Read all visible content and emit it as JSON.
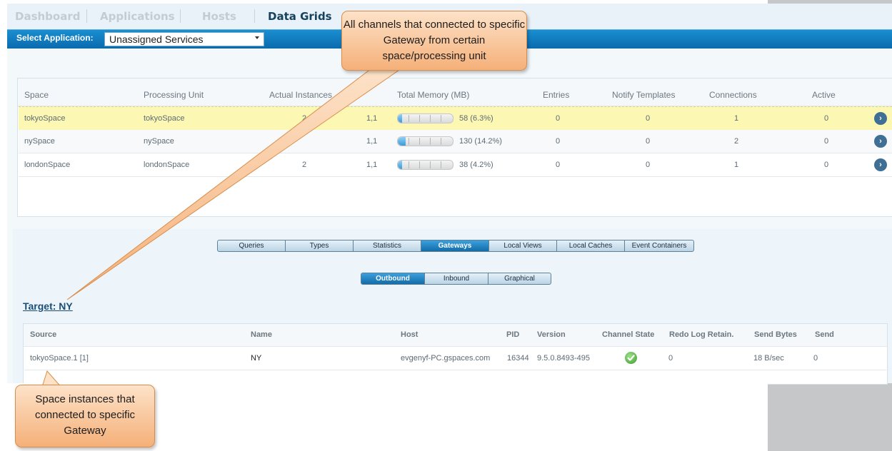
{
  "nav": {
    "items": [
      "Dashboard",
      "Applications",
      "Hosts",
      "Data Grids"
    ],
    "active": "Data Grids"
  },
  "select_application": {
    "label": "Select Application:",
    "value": "Unassigned Services"
  },
  "spaces_table": {
    "headers": [
      "Space",
      "Processing Unit",
      "Actual Instances",
      "Total Memory (MB)",
      "Entries",
      "Notify Templates",
      "Connections",
      "Active"
    ],
    "rows": [
      {
        "space": "tokyoSpace",
        "pu": "tokyoSpace",
        "instances": "2",
        "topology": "1,1",
        "memory": "58 (6.3%)",
        "memory_fill": 0.063,
        "entries": "0",
        "notify": "0",
        "connections": "1",
        "active": "0",
        "selected": true
      },
      {
        "space": "nySpace",
        "pu": "nySpace",
        "instances": "",
        "topology": "1,1",
        "memory": "130 (14.2%)",
        "memory_fill": 0.142,
        "entries": "0",
        "notify": "0",
        "connections": "2",
        "active": "0",
        "selected": false
      },
      {
        "space": "londonSpace",
        "pu": "londonSpace",
        "instances": "2",
        "topology": "1,1",
        "memory": "38 (4.2%)",
        "memory_fill": 0.042,
        "entries": "0",
        "notify": "0",
        "connections": "1",
        "active": "0",
        "selected": false
      }
    ],
    "row_action_icon": "chevron-right-icon"
  },
  "detail_tabs": {
    "items": [
      "Queries",
      "Types",
      "Statistics",
      "Gateways",
      "Local Views",
      "Local Caches",
      "Event Containers"
    ],
    "active": "Gateways"
  },
  "gateway_tabs": {
    "items": [
      "Outbound",
      "Inbound",
      "Graphical"
    ],
    "active": "Outbound"
  },
  "target_title": "Target: NY",
  "gateway_table": {
    "headers": [
      "Source",
      "Name",
      "Host",
      "PID",
      "Version",
      "Channel State",
      "Redo Log Retain.",
      "Send Bytes",
      "Send"
    ],
    "rows": [
      {
        "source": "tokyoSpace.1 [1]",
        "name": "NY",
        "host": "evgenyf-PC.gspaces.com",
        "pid": "16344",
        "version": "9.5.0.8493-495",
        "channel_state_icon": "check-icon",
        "redo": "0",
        "send_bytes": "18 B/sec",
        "send": "0"
      }
    ]
  },
  "callouts": {
    "top": "All channels that connected to specific Gateway from certain space/processing unit",
    "bottom": "Space instances that connected to specific Gateway"
  },
  "colors": {
    "accent": "#0a6aae",
    "callout_fill": "#f5b079",
    "selected_row": "#fdf7b4",
    "check": "#3d9c2c"
  }
}
